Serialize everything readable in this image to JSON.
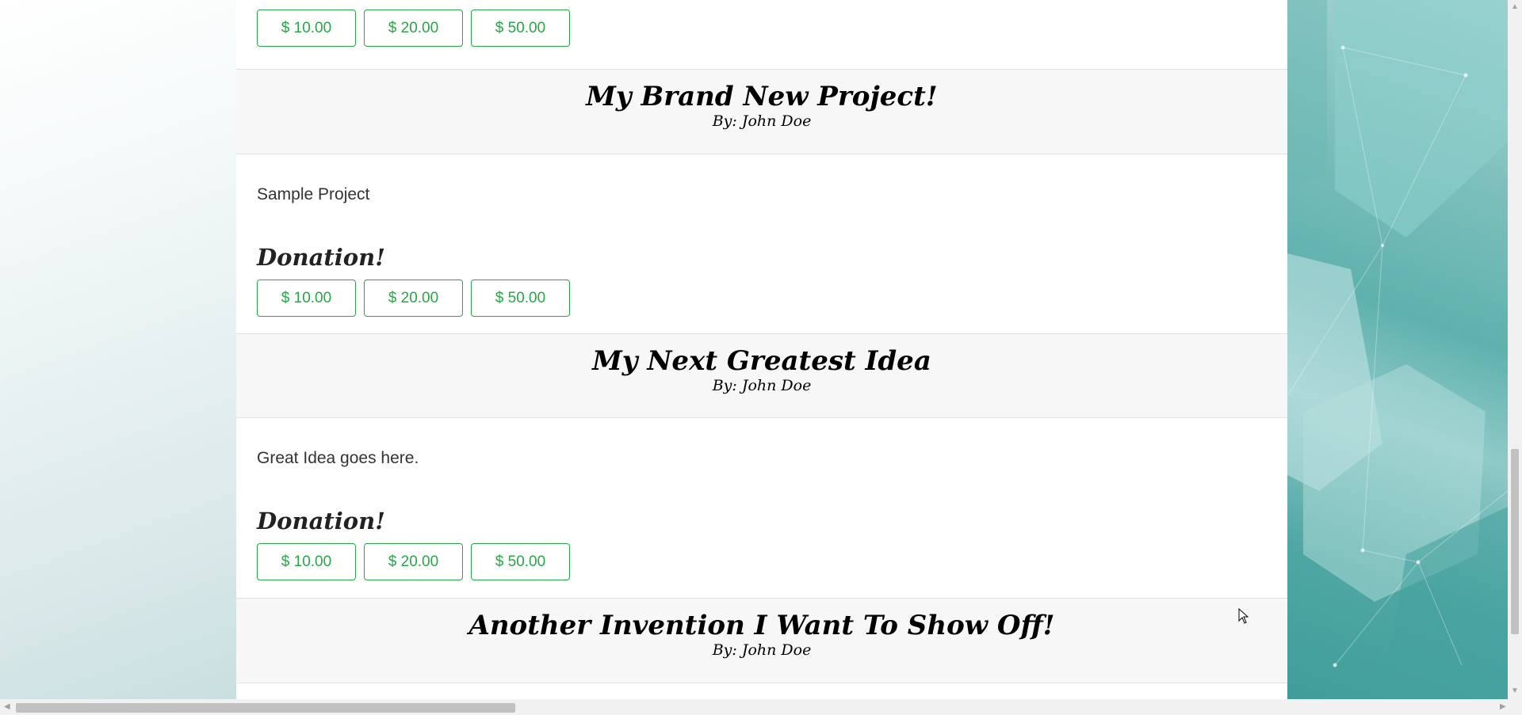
{
  "projects": [
    {
      "title": "",
      "author": "",
      "description": "",
      "donation_title": "",
      "amounts": [
        "$ 10.00",
        "$ 20.00",
        "$ 50.00"
      ]
    },
    {
      "title": "My Brand New Project!",
      "author": "By: John Doe",
      "description": "Sample Project",
      "donation_title": "Donation!",
      "amounts": [
        "$ 10.00",
        "$ 20.00",
        "$ 50.00"
      ]
    },
    {
      "title": "My Next Greatest Idea",
      "author": "By: John Doe",
      "description": "Great Idea goes here.",
      "donation_title": "Donation!",
      "amounts": [
        "$ 10.00",
        "$ 20.00",
        "$ 50.00"
      ]
    },
    {
      "title": "Another Invention I Want To Show Off!",
      "author": "By: John Doe"
    }
  ],
  "colors": {
    "button_accent": "#28a745",
    "header_bg": "#f7f7f7",
    "right_panel": "#5fb1ae"
  },
  "icons": {
    "scroll_up": "chevron-up-icon",
    "scroll_down": "chevron-down-icon",
    "scroll_left": "chevron-left-icon",
    "scroll_right": "chevron-right-icon",
    "cursor": "mouse-pointer-icon"
  }
}
